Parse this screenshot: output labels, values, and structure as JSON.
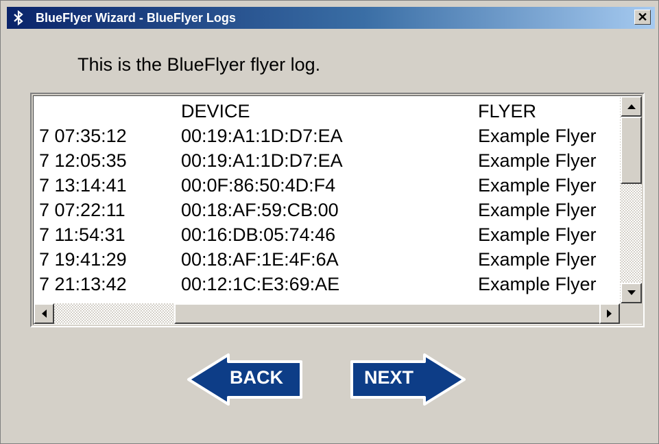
{
  "window": {
    "title": "BlueFlyer Wizard - BlueFlyer Logs",
    "title_icon": "bluetooth-icon",
    "close_glyph": "✕"
  },
  "intro_text": "This is the BlueFlyer flyer log.",
  "log": {
    "headers": [
      "",
      "DEVICE",
      "FLYER"
    ],
    "rows": [
      [
        "7 07:35:12",
        "00:19:A1:1D:D7:EA",
        "Example Flyer"
      ],
      [
        "7 12:05:35",
        "00:19:A1:1D:D7:EA",
        "Example Flyer"
      ],
      [
        "7 13:14:41",
        "00:0F:86:50:4D:F4",
        "Example Flyer"
      ],
      [
        "7 07:22:11",
        "00:18:AF:59:CB:00",
        "Example Flyer"
      ],
      [
        "7 11:54:31",
        "00:16:DB:05:74:46",
        "Example Flyer"
      ],
      [
        "7 19:41:29",
        "00:18:AF:1E:4F:6A",
        "Example Flyer"
      ],
      [
        "7 21:13:42",
        "00:12:1C:E3:69:AE",
        "Example Flyer"
      ]
    ]
  },
  "buttons": {
    "back": "BACK",
    "next": "NEXT"
  },
  "colors": {
    "button_fill": "#0d3d87",
    "title_start": "#0a246a",
    "title_end": "#a6caf0"
  }
}
